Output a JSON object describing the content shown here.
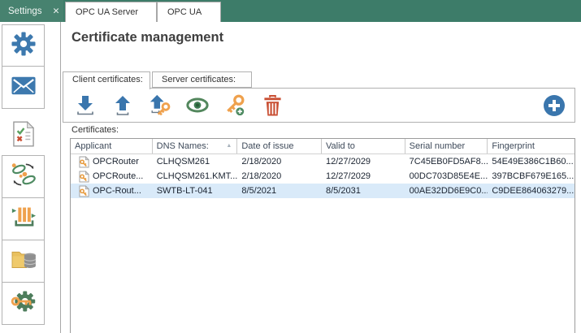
{
  "window": {
    "tabs": [
      {
        "label": "Settings",
        "active": true,
        "close_glyph": "✕"
      },
      {
        "label": "OPC UA Server",
        "active": false
      },
      {
        "label": "OPC UA",
        "active": false
      }
    ]
  },
  "sidebar": {
    "items": [
      {
        "name": "settings",
        "icon": "gear-icon"
      },
      {
        "name": "mail",
        "icon": "envelope-icon"
      },
      {
        "name": "certificates",
        "icon": "certificate-document-icon",
        "active": true
      },
      {
        "name": "transfer",
        "icon": "sync-rings-icon"
      },
      {
        "name": "import-data",
        "icon": "orange-bars-icon"
      },
      {
        "name": "storage",
        "icon": "folder-database-icon"
      },
      {
        "name": "security",
        "icon": "gear-key-icon"
      }
    ]
  },
  "main": {
    "title": "Certificate management",
    "cert_tabs": [
      {
        "label": "Client certificates:",
        "active": true
      },
      {
        "label": "Server certificates:",
        "active": false
      }
    ],
    "toolbar": {
      "icons": [
        "import-certificate",
        "export-certificate",
        "export-with-private-key",
        "view-certificate",
        "create-key",
        "delete-certificate",
        "add-certificate"
      ]
    },
    "certificates_label": "Certificates:",
    "table": {
      "columns": [
        "Applicant",
        "DNS Names:",
        "Date of issue",
        "Valid to",
        "Serial number",
        "Fingerprint"
      ],
      "sort_column": "DNS Names:",
      "sort_indicator": "▲",
      "rows": [
        {
          "applicant": "OPCRouter",
          "dns": "CLHQSM261",
          "issued": "2/18/2020",
          "valid_to": "12/27/2029",
          "serial": "7C45EB0FD5AF8...",
          "fingerprint": "54E49E386C1B60...",
          "selected": false
        },
        {
          "applicant": "OPCRoute...",
          "dns": "CLHQSM261.KMT....",
          "issued": "2/18/2020",
          "valid_to": "12/27/2029",
          "serial": "00DC703D85E4E...",
          "fingerprint": "397BCBF679E165...",
          "selected": false
        },
        {
          "applicant": "OPC-Rout...",
          "dns": "SWTB-LT-041",
          "issued": "8/5/2021",
          "valid_to": "8/5/2031",
          "serial": "00AE32DD6E9C0...",
          "fingerprint": "C9DEE864063279...",
          "selected": true
        }
      ]
    }
  },
  "colors": {
    "tabbar_green": "#3d7c69",
    "accent_blue": "#3a76ad",
    "icon_green": "#53875d",
    "icon_orange": "#efa14d",
    "icon_red": "#c94f33",
    "selection_blue": "#d9eaf9"
  }
}
